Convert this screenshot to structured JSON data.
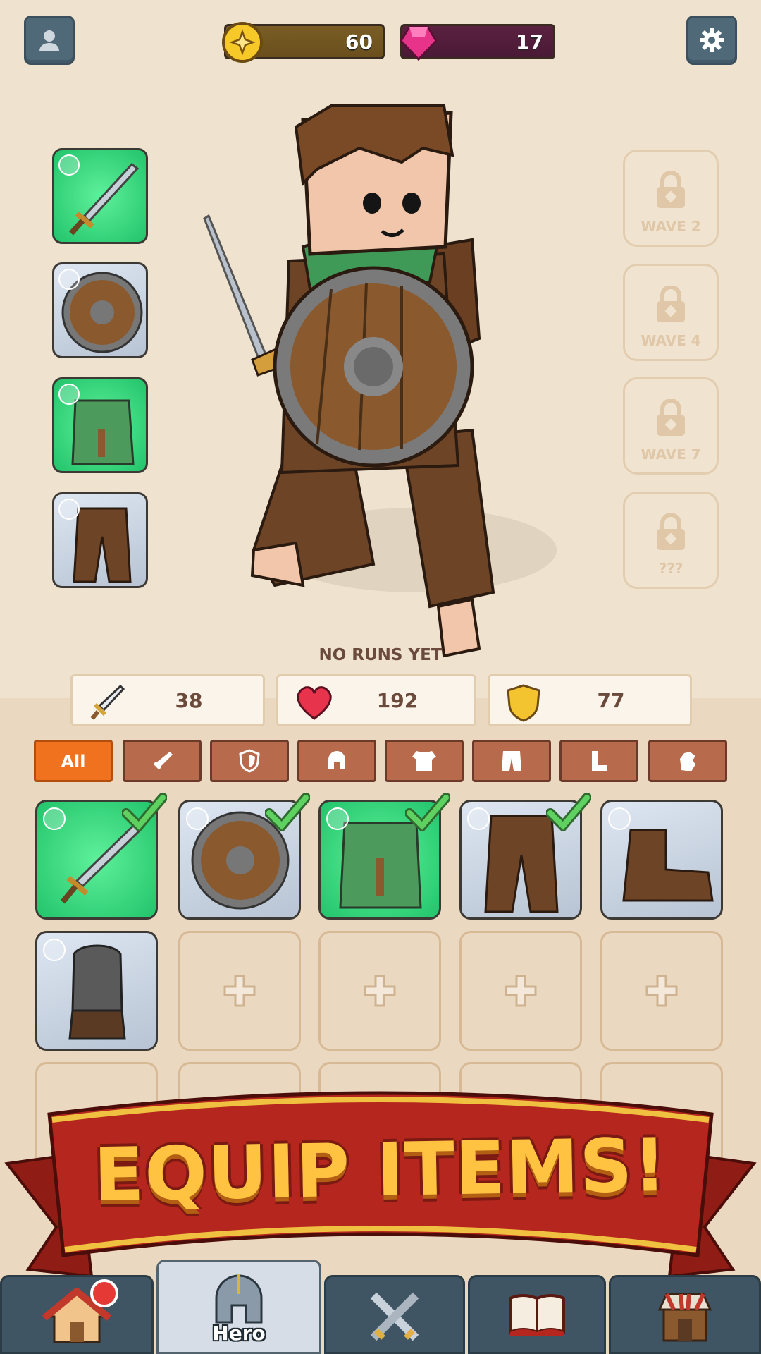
{
  "topbar": {
    "profile_icon": "person-icon",
    "settings_icon": "gear-icon",
    "gold": "60",
    "gems": "17"
  },
  "hero": {
    "equipped_slots": [
      {
        "name": "sword",
        "icon": "sword-icon"
      },
      {
        "name": "shield",
        "icon": "shield-icon"
      },
      {
        "name": "chest armor",
        "icon": "armor-icon"
      },
      {
        "name": "pants",
        "icon": "pants-icon"
      }
    ],
    "locked_slots": [
      {
        "label": "WAVE 2"
      },
      {
        "label": "WAVE 4"
      },
      {
        "label": "WAVE 7"
      },
      {
        "label": "???"
      }
    ],
    "status": "NO RUNS YET"
  },
  "stats": {
    "attack": "38",
    "health": "192",
    "defense": "77"
  },
  "filters": [
    {
      "label": "All",
      "icon": ""
    },
    {
      "label": "",
      "icon": "sword-icon"
    },
    {
      "label": "",
      "icon": "shield-icon"
    },
    {
      "label": "",
      "icon": "helmet-icon"
    },
    {
      "label": "",
      "icon": "armor-icon"
    },
    {
      "label": "",
      "icon": "pants-icon"
    },
    {
      "label": "",
      "icon": "boots-icon"
    },
    {
      "label": "",
      "icon": "gloves-icon"
    }
  ],
  "banner": {
    "text": "EQUIP ITEMS!"
  },
  "nav": {
    "home": {
      "label": "",
      "icon": "home-icon"
    },
    "hero": {
      "label": "Hero",
      "icon": "helmet-icon"
    },
    "battle": {
      "label": "",
      "icon": "crossed-swords-icon"
    },
    "codex": {
      "label": "",
      "icon": "book-icon"
    },
    "shop": {
      "label": "",
      "icon": "shop-icon"
    }
  },
  "colors": {
    "accent_orange": "#f0721e",
    "tab_brown": "#b86a4c",
    "equipped_green": "#22c46b",
    "nav_slate": "#3f5563",
    "banner_red": "#b5261e",
    "banner_gold": "#ffc341"
  }
}
